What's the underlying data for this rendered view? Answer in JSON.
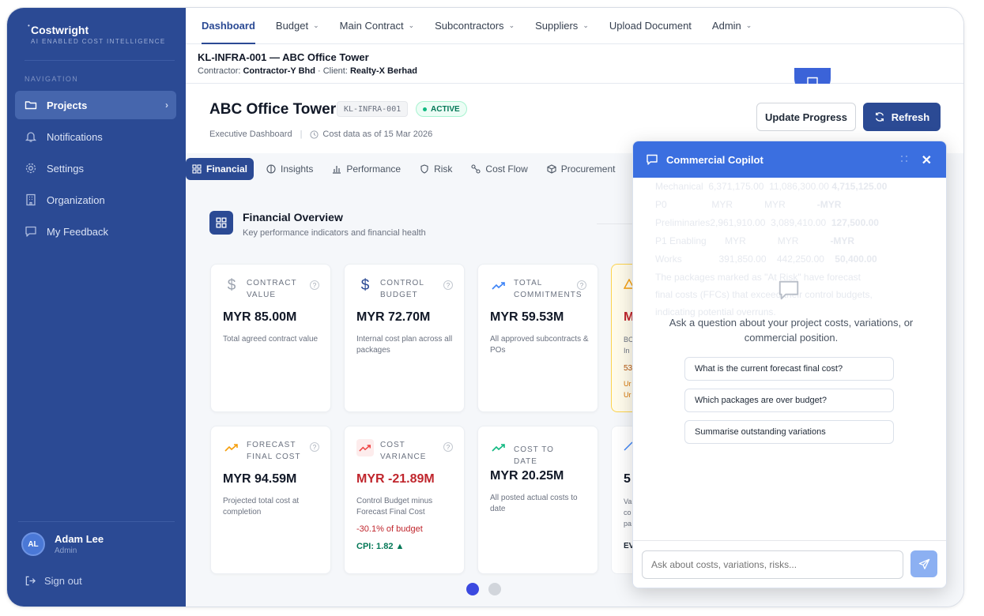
{
  "brand": {
    "name": "Costwright",
    "tagline": "AI ENABLED COST INTELLIGENCE"
  },
  "sidebar": {
    "section_label": "NAVIGATION",
    "items": [
      {
        "label": "Projects",
        "icon": "folder-icon",
        "active": true
      },
      {
        "label": "Notifications",
        "icon": "bell-icon"
      },
      {
        "label": "Settings",
        "icon": "gear-icon"
      },
      {
        "label": "Organization",
        "icon": "building-icon"
      },
      {
        "label": "My Feedback",
        "icon": "chat-icon"
      }
    ],
    "user": {
      "initials": "AL",
      "name": "Adam Lee",
      "role": "Admin"
    },
    "signout": "Sign out"
  },
  "topnav": {
    "tabs": [
      {
        "label": "Dashboard"
      },
      {
        "label": "Budget"
      },
      {
        "label": "Main Contract"
      },
      {
        "label": "Subcontractors"
      },
      {
        "label": "Suppliers"
      },
      {
        "label": "Upload Document"
      },
      {
        "label": "Admin"
      }
    ]
  },
  "project": {
    "title": "KL-INFRA-001 — ABC Office Tower",
    "contractor_label": "Contractor:",
    "contractor": "Contractor-Y Bhd",
    "client_label": "· Client:",
    "client": "Realty-X Berhad"
  },
  "header": {
    "title": "ABC Office Tower",
    "code": "KL-INFRA-001",
    "status": "ACTIVE",
    "subtitle": "Executive Dashboard",
    "as_of": "Cost data as of 15 Mar 2026",
    "update_button": "Update Progress",
    "refresh_button": "Refresh"
  },
  "subtabs": [
    {
      "label": "Financial",
      "icon": "grid-icon",
      "active": true
    },
    {
      "label": "Insights",
      "icon": "brain-icon"
    },
    {
      "label": "Performance",
      "icon": "bar-chart-icon"
    },
    {
      "label": "Risk",
      "icon": "shield-icon"
    },
    {
      "label": "Cost Flow",
      "icon": "flow-icon"
    },
    {
      "label": "Procurement",
      "icon": "box-icon"
    }
  ],
  "overview": {
    "title": "Financial Overview",
    "subtitle": "Key performance indicators and financial health"
  },
  "cards": [
    {
      "label": "CONTRACT VALUE",
      "value": "MYR 85.00M",
      "desc": "Total agreed contract value",
      "icon": "dollar-icon",
      "icon_color": "#9ca3af"
    },
    {
      "label": "CONTROL BUDGET",
      "value": "MYR 72.70M",
      "desc": "Internal cost plan across all packages",
      "icon": "dollar-icon",
      "icon_color": "#2b4a94"
    },
    {
      "label": "TOTAL COMMITMENTS",
      "value": "MYR 59.53M",
      "desc": "All approved subcontracts & POs",
      "icon": "trend-up-icon",
      "icon_color": "#3b82f6"
    },
    {
      "label": "FORECAST FINAL COST",
      "value": "MYR 94.59M",
      "desc": "Projected total cost at completion",
      "icon": "trend-up-icon",
      "icon_color": "#f59e0b"
    },
    {
      "label": "COST VARIANCE",
      "value": "MYR -21.89M",
      "desc": "Control Budget minus Forecast Final Cost",
      "extra": "-30.1% of budget",
      "extra2": "CPI: 1.82 ▲",
      "icon": "trend-up-icon",
      "icon_color": "#ef4444",
      "negative": true
    },
    {
      "label": "COST TO DATE",
      "value": "MYR 20.25M",
      "desc": "All posted actual costs to date",
      "icon": "trend-up-icon",
      "icon_color": "#10b981"
    }
  ],
  "partial_cards": {
    "top": {
      "value": "M",
      "lines": [
        "BC",
        "In",
        "53",
        "Ur",
        "Ur"
      ]
    },
    "bottom": {
      "value": "5",
      "lines": [
        "Va",
        "co",
        "pa",
        "EV"
      ]
    }
  },
  "pagination": {
    "pages": 2,
    "current": 1
  },
  "copilot": {
    "title": "Commercial Copilot",
    "prompt": "Ask a question about your project costs, variations, or commercial position.",
    "suggestions": [
      "What is the current forecast final cost?",
      "Which packages are over budget?",
      "Summarise outstanding variations"
    ],
    "input_placeholder": "Ask about costs, variations, risks...",
    "background_rows": [
      [
        "Mechanical",
        "6,371,175.00",
        "11,086,300.00",
        "4,715,125.00"
      ],
      [
        "P0",
        "MYR",
        "MYR",
        "-MYR"
      ],
      [
        "Preliminaries",
        "2,961,910.00",
        "3,089,410.00",
        "127,500.00"
      ],
      [
        "P1 Enabling",
        "MYR",
        "MYR",
        "-MYR"
      ],
      [
        "Works",
        "391,850.00",
        "442,250.00",
        "50,400.00"
      ]
    ],
    "background_text": [
      "The packages marked as \"At Risk\" have forecast",
      "final costs (FFCs) that exceed their control budgets,",
      "indicating potential overruns."
    ]
  },
  "colors": {
    "primary": "#2b4a94",
    "copilot_blue": "#3b6fe0",
    "negative": "#c0262d",
    "positive": "#047857"
  }
}
